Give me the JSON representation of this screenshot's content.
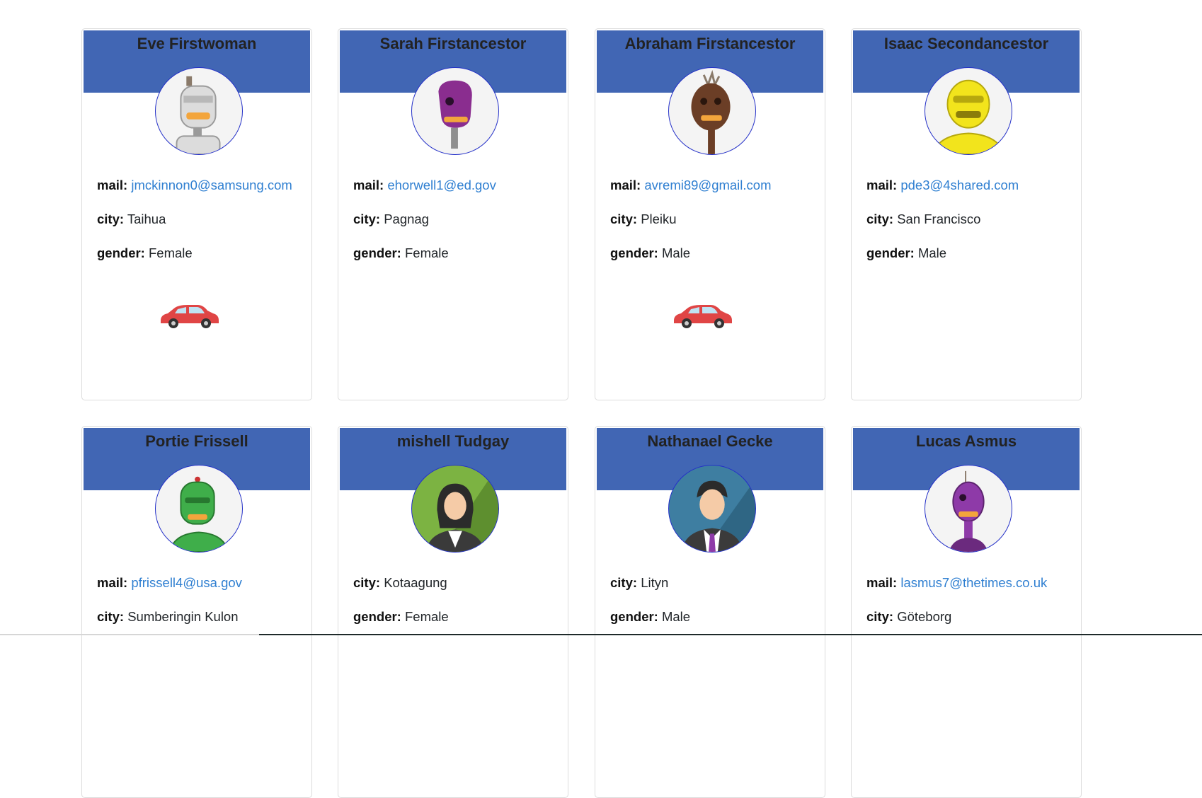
{
  "labels": {
    "mail": "mail:",
    "city": "city:",
    "gender": "gender:"
  },
  "cards": [
    {
      "name": "Eve Firstwoman",
      "avatar": "robot-gray-icon",
      "mail": "jmckinnon0@samsung.com",
      "city": "Taihua",
      "gender": "Female",
      "has_car": true
    },
    {
      "name": "Sarah Firstancestor",
      "avatar": "robot-purple-icon",
      "mail": "ehorwell1@ed.gov",
      "city": "Pagnag",
      "gender": "Female",
      "has_car": false
    },
    {
      "name": "Abraham Firstancestor",
      "avatar": "robot-brown-icon",
      "mail": "avremi89@gmail.com",
      "city": "Pleiku",
      "gender": "Male",
      "has_car": true
    },
    {
      "name": "Isaac Secondancestor",
      "avatar": "robot-yellow-icon",
      "mail": "pde3@4shared.com",
      "city": "San Francisco",
      "gender": "Male",
      "has_car": false
    },
    {
      "name": "Portie Frissell",
      "avatar": "robot-green-icon",
      "mail": "pfrissell4@usa.gov",
      "city": "Sumberingin Kulon",
      "gender": "",
      "has_car": false
    },
    {
      "name": "mishell Tudgay",
      "avatar": "woman-avatar-icon",
      "mail": "",
      "city": "Kotaagung",
      "gender": "Female",
      "has_car": false
    },
    {
      "name": "Nathanael Gecke",
      "avatar": "man-avatar-icon",
      "mail": "",
      "city": "Lityn",
      "gender": "Male",
      "has_car": false
    },
    {
      "name": "Lucas Asmus",
      "avatar": "robot-violet-icon",
      "mail": "lasmus7@thetimes.co.uk",
      "city": "Göteborg",
      "gender": "",
      "has_car": false
    }
  ],
  "colors": {
    "header": "#4166b4",
    "link": "#2f7fd1",
    "avatar_border": "#2430c8",
    "car": "#e04545"
  }
}
